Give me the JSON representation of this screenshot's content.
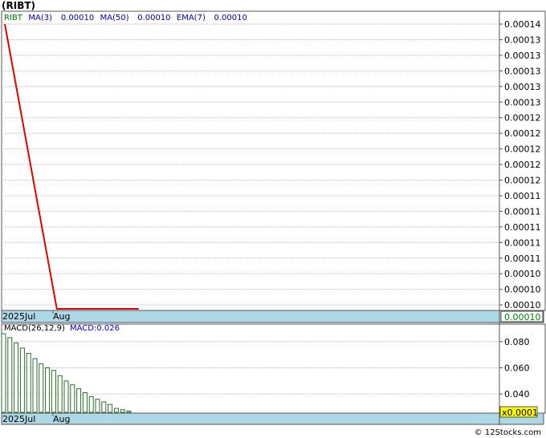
{
  "title": "(RIBT)",
  "credit": "© 12Stocks.com",
  "chart_data": [
    {
      "type": "line",
      "title": "",
      "legend": [
        {
          "label": "RIBT",
          "color": "#008000"
        },
        {
          "label": "MA(3)",
          "color": "#0000aa"
        },
        {
          "label": "0.00010",
          "color": "#0000aa"
        },
        {
          "label": "MA(50)",
          "color": "#0000aa"
        },
        {
          "label": "0.00010",
          "color": "#0000aa"
        },
        {
          "label": "EMA(7)",
          "color": "#0000aa"
        },
        {
          "label": "0.00010",
          "color": "#0000aa"
        }
      ],
      "y_ticks": [
        "0.00014",
        "0.00013",
        "0.00013",
        "0.00013",
        "0.00013",
        "0.00013",
        "0.00012",
        "0.00012",
        "0.00012",
        "0.00012",
        "0.00012",
        "0.00011",
        "0.00011",
        "0.00011",
        "0.00011",
        "0.00011",
        "0.00010",
        "0.00010",
        "0.00010"
      ],
      "ylim": [
        0.0001,
        0.00014
      ],
      "x_labels": [
        "2025Jul",
        "Aug"
      ],
      "current_value_label": "0.00010",
      "series": [
        {
          "color": "#dd0000",
          "points": [
            [
              0,
              0.00014
            ],
            [
              14,
              0.0001
            ],
            [
              36,
              0.0001
            ]
          ]
        }
      ],
      "x_range": [
        0,
        133
      ],
      "grid": true
    },
    {
      "type": "bar",
      "title": "",
      "legend": [
        {
          "label": "MACD(26,12,9)",
          "color": "#000000"
        },
        {
          "label": "MACD:0.026",
          "color": "#0000cc"
        }
      ],
      "y_ticks": [
        "0.080",
        "0.060",
        "0.040"
      ],
      "ylim": [
        0.026,
        0.086
      ],
      "x_labels": [
        "2025Jul",
        "Aug"
      ],
      "multiplier_label": "x0.0001",
      "values": [
        0.086,
        0.083,
        0.079,
        0.075,
        0.071,
        0.067,
        0.063,
        0.06,
        0.058,
        0.054,
        0.05,
        0.047,
        0.044,
        0.041,
        0.038,
        0.036,
        0.034,
        0.032,
        0.029,
        0.028,
        0.027
      ],
      "bar_color": "#2e6b2e",
      "grid": true
    }
  ]
}
